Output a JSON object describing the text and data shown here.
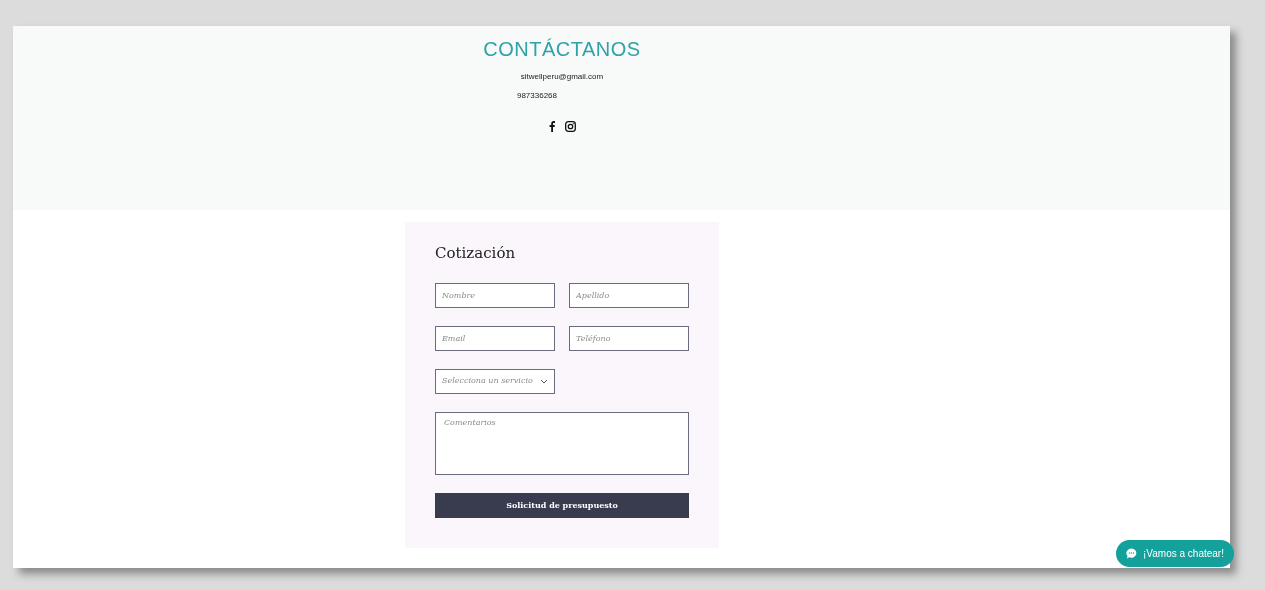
{
  "contact": {
    "title": "CONTÁCTANOS",
    "email": "sitwellperu@gmail.com",
    "phone": "987336268"
  },
  "form": {
    "title": "Cotización",
    "fields": [
      {
        "kind": "input",
        "placeholder": "Nombre"
      },
      {
        "kind": "input",
        "placeholder": "Apellido"
      },
      {
        "kind": "input",
        "placeholder": "Email"
      },
      {
        "kind": "input",
        "placeholder": "Teléfono"
      },
      {
        "kind": "select",
        "placeholder": "Selecciona un servicio"
      },
      {
        "kind": "textarea",
        "placeholder": "Comentarios"
      }
    ],
    "submit": "Solicitud de presupuesto"
  },
  "chat": {
    "label": "¡Vamos a chatear!"
  }
}
